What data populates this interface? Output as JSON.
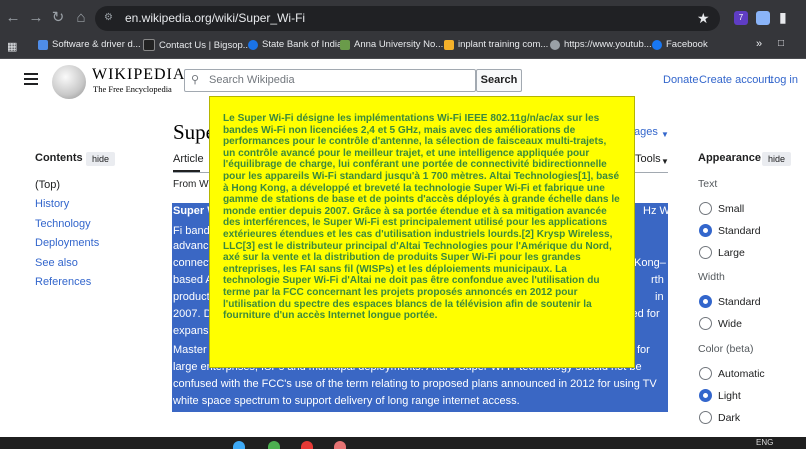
{
  "browser": {
    "url": "en.wikipedia.org/wiki/Super_Wi-Fi",
    "bookmarks": [
      "Software & driver d...",
      "Contact Us | Bigsop...",
      "State Bank of India",
      "Anna University No...",
      "inplant training com...",
      "https://www.youtub...",
      "Facebook"
    ],
    "bookmark_colors": [
      "#4f8de8",
      "#222222",
      "#1a73e8",
      "#6a9b4a",
      "#f5b12a",
      "#9aa0a6",
      "#1877f2"
    ],
    "ext_badge": "7"
  },
  "wiki": {
    "wordmark": "WIKIPEDIA",
    "tagline": "The Free Encyclopedia",
    "search_placeholder": "Search Wikipedia",
    "search_button": "Search",
    "links": [
      "Donate",
      "Create account",
      "Log in"
    ],
    "title": "Supe",
    "languages_fragment": "ages",
    "tools_fragment": "Tools",
    "tab_article": "Article",
    "from_fragment": "From Wi",
    "contents_heading": "Contents",
    "hide_label": "hide",
    "toc": [
      "(Top)",
      "History",
      "Technology",
      "Deployments",
      "See also",
      "References"
    ],
    "appearance_heading": "Appearance",
    "text_heading": "Text",
    "text_options": [
      "Small",
      "Standard",
      "Large"
    ],
    "width_heading": "Width",
    "width_options": [
      "Standard",
      "Wide"
    ],
    "color_heading": "Color (beta)",
    "color_options": [
      "Automatic",
      "Light",
      "Dark"
    ],
    "article_fragments": [
      {
        "left": "Super W",
        "right": "Hz Wi-"
      },
      {
        "left": "Fi band",
        "right": ""
      },
      {
        "left": "advanc",
        "right": ""
      },
      {
        "left": "connect",
        "right": "Kong–"
      },
      {
        "left": "based A",
        "right": "rth"
      },
      {
        "left": "product",
        "right": "in"
      },
      {
        "left": "2007. D",
        "right": "sed for"
      },
      {
        "left": "expans",
        "right": ""
      },
      {
        "left": "Master",
        "right": "for"
      },
      {
        "left": "large enterprises, ISPs and municipal deployments. Altai's Super Wi-Fi technology should not be",
        "right": ""
      },
      {
        "left": "confused with the FCC's use of the term relating to proposed plans announced in 2012 for using TV",
        "right": ""
      },
      {
        "left": "white space spectrum to support delivery of long range internet access.",
        "right": ""
      }
    ]
  },
  "popup": {
    "text": "Le Super Wi-Fi désigne les implémentations Wi-Fi IEEE 802.11g/n/ac/ax sur les bandes Wi-Fi non licenciées 2,4 et 5 GHz, mais avec des améliorations de performances pour le contrôle d'antenne, la sélection de faisceaux multi-trajets, un contrôle avancé pour le meilleur trajet, et une intelligence appliquée pour l'équilibrage de charge, lui conférant une portée de connectivité bidirectionnelle pour les appareils Wi-Fi standard jusqu'à 1 700 mètres. Altai Technologies[1], basé à Hong Kong, a développé et breveté la technologie Super Wi-Fi et fabrique une gamme de stations de base et de points d'accès déployés à grande échelle dans le monde entier depuis 2007. Grâce à sa portée étendue et à sa mitigation avancée des interférences, le Super Wi-Fi est principalement utilisé pour les applications extérieures étendues et les cas d'utilisation industriels lourds.[2] Krysp Wireless, LLC[3] est le distributeur principal d'Altai Technologies pour l'Amérique du Nord, axé sur la vente et la distribution de produits Super Wi-Fi pour les grandes entreprises, les FAI sans fil (WISPs) et les déploiements municipaux. La technologie Super Wi-Fi d'Altai ne doit pas être confondue avec l'utilisation du terme par la FCC concernant les projets proposés annoncés en 2012 pour l'utilisation du spectre des espaces blancs de la télévision afin de soutenir la fourniture d'un accès Internet longue portée.",
    "bg": "#ffff00",
    "fg": "#3c8a3c"
  },
  "taskbar": {
    "lang": "ENG"
  }
}
